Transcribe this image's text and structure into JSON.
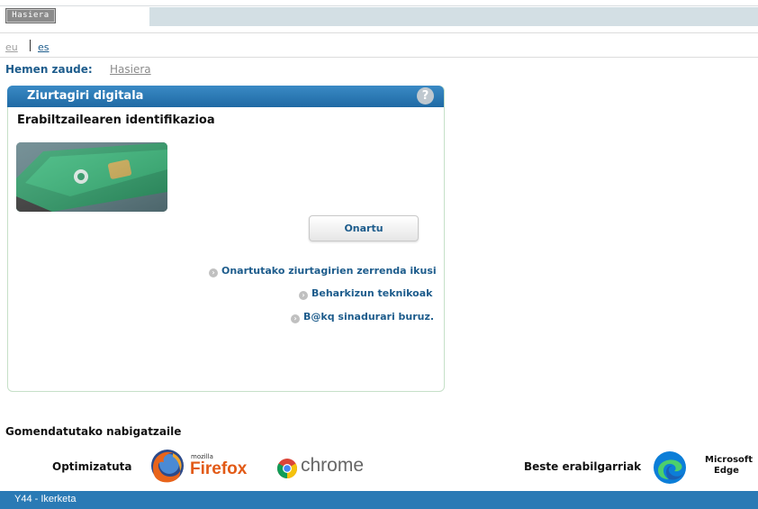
{
  "header": {
    "home_button": "Hasiera"
  },
  "languages": {
    "eu": "eu",
    "es": "es"
  },
  "breadcrumb": {
    "label": "Hemen zaude:",
    "current": "Hasiera"
  },
  "panel": {
    "title": "Ziurtagiri digitala",
    "help_icon": "help-icon",
    "subtitle": "Erabiltzailearen identifikazioa",
    "accept_button": "Onartu",
    "links": [
      "Onartutako ziurtagirien zerrenda ikusi",
      "Beharkizun teknikoak",
      "B@kq sinadurari buruz."
    ]
  },
  "browsers": {
    "title": "Gomendatutako nabigatzaile",
    "optimized_label": "Optimizatuta",
    "firefox_small": "mozilla",
    "firefox_name": "Firefox",
    "chrome_name": "chrome",
    "others_label": "Beste erabilgarriak",
    "edge_line1": "Microsoft",
    "edge_line2": "Edge"
  },
  "footer": {
    "text": "Y44 - Ikerketa"
  },
  "colors": {
    "accent": "#2a7ab5",
    "link": "#1d5c8c",
    "topbar": "#d3dfe4"
  }
}
